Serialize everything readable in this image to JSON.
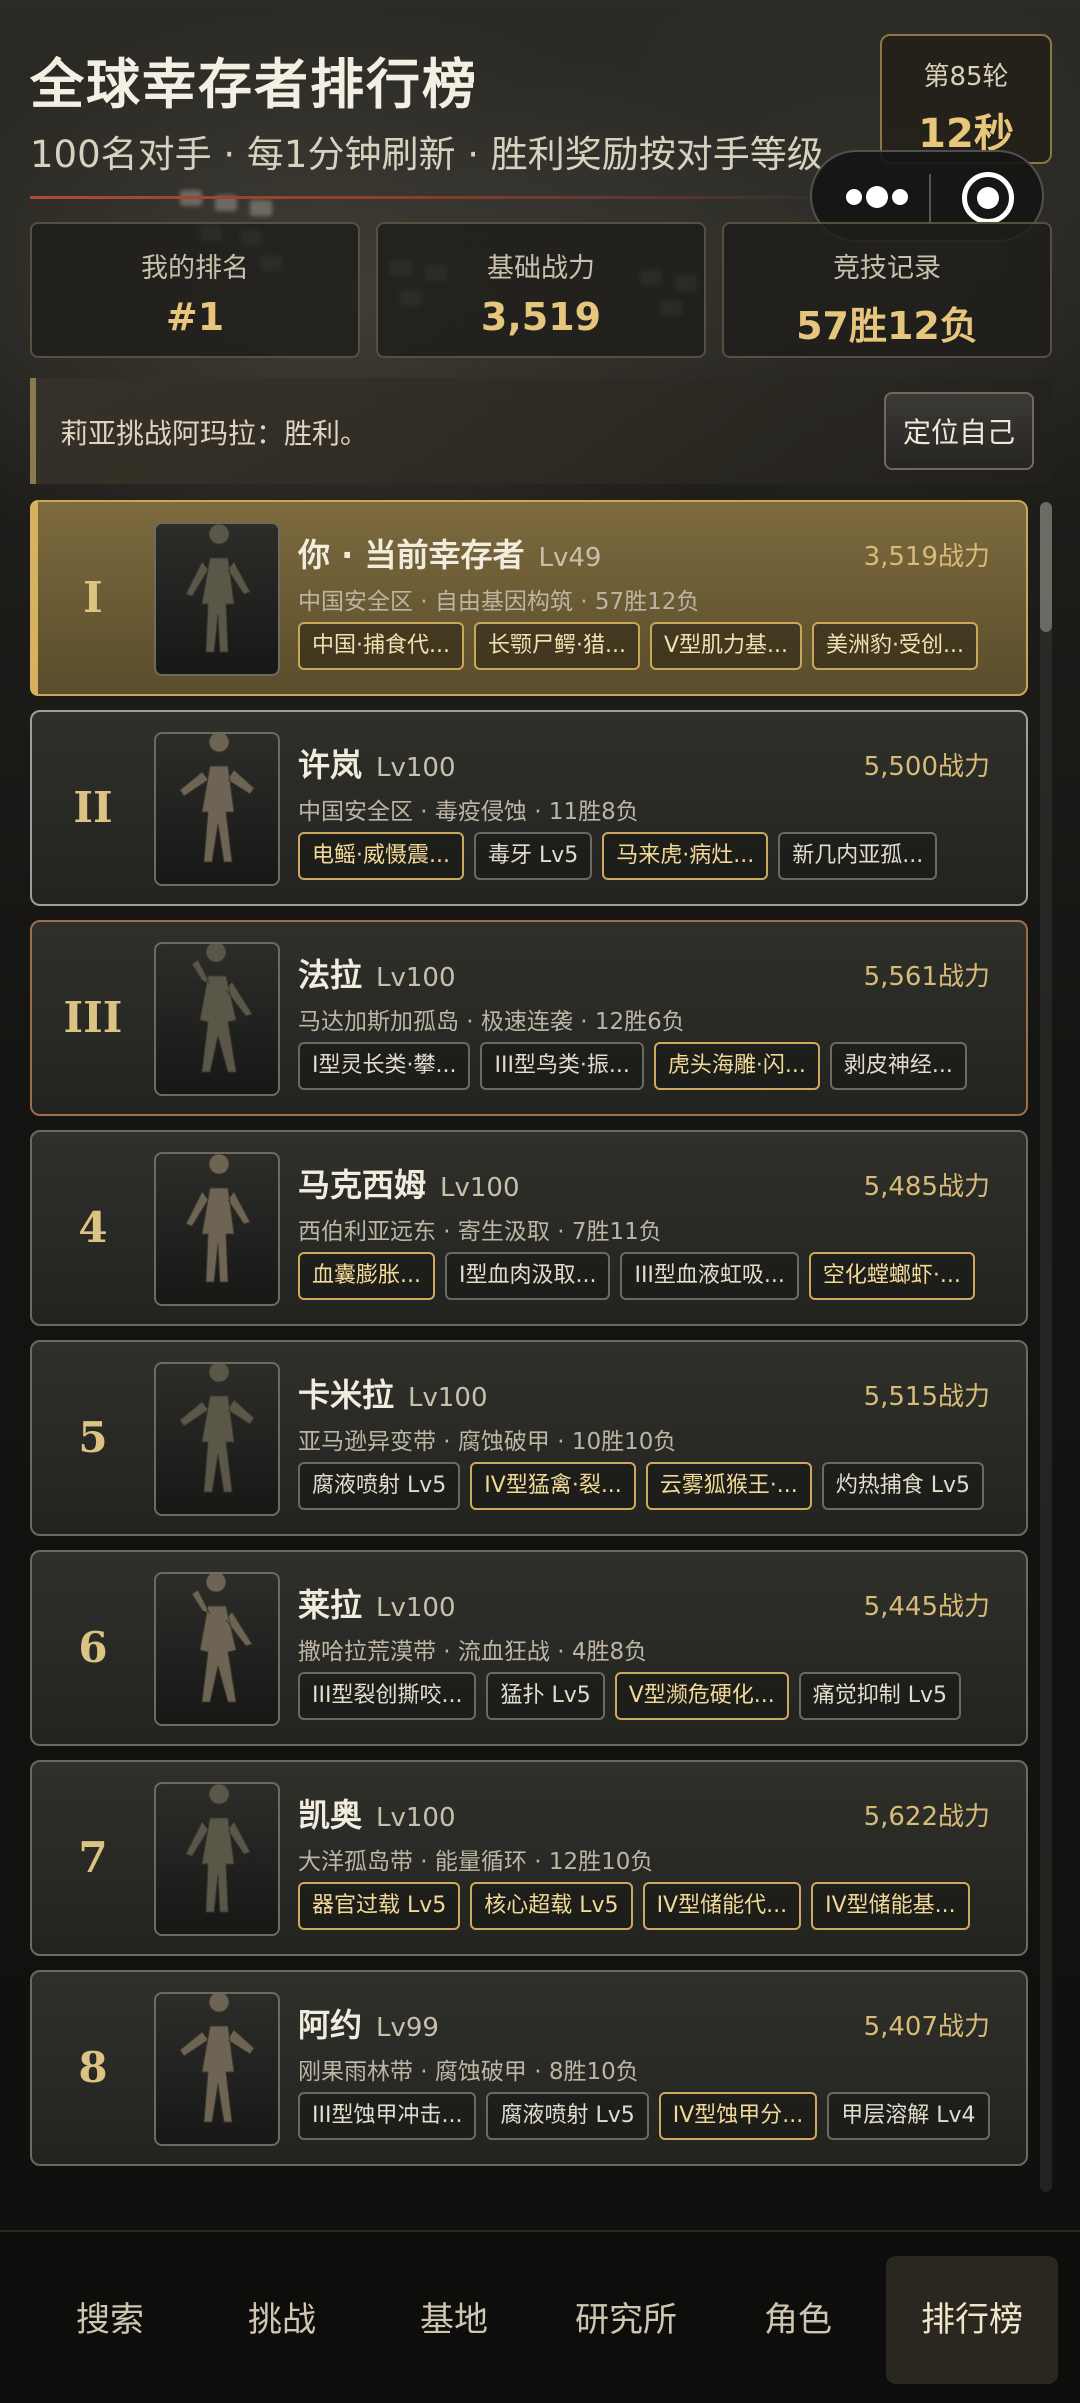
{
  "header": {
    "title": "全球幸存者排行榜",
    "subtitle": "100名对手 · 每1分钟刷新 · 胜利奖励按对手等级",
    "round_label": "第85轮",
    "round_countdown": "12秒"
  },
  "stats": [
    {
      "label": "我的排名",
      "value": "#1"
    },
    {
      "label": "基础战力",
      "value": "3,519"
    },
    {
      "label": "竞技记录",
      "value": "57胜12负"
    }
  ],
  "notice": {
    "text": "莉亚挑战阿玛拉：胜利。",
    "button": "定位自己"
  },
  "leaderboard": [
    {
      "rank": "I",
      "name": "你 · 当前幸存者",
      "level": "Lv49",
      "power": "3,519战力",
      "meta": "中国安全区 · 自由基因构筑 · 57胜12负",
      "tags": [
        {
          "text": "中国·捕食代...",
          "gold": true
        },
        {
          "text": "长颚尸鳄·猎...",
          "gold": true
        },
        {
          "text": "V型肌力基...",
          "gold": true
        },
        {
          "text": "美洲豹·受创...",
          "gold": true
        }
      ]
    },
    {
      "rank": "II",
      "name": "许岚",
      "level": "Lv100",
      "power": "5,500战力",
      "meta": "中国安全区 · 毒疫侵蚀 · 11胜8负",
      "tags": [
        {
          "text": "电鳐·威慑震...",
          "gold": true
        },
        {
          "text": "毒牙 Lv5",
          "gold": false
        },
        {
          "text": "马来虎·病灶...",
          "gold": true
        },
        {
          "text": "新几内亚孤...",
          "gold": false
        }
      ]
    },
    {
      "rank": "III",
      "name": "法拉",
      "level": "Lv100",
      "power": "5,561战力",
      "meta": "马达加斯加孤岛 · 极速连袭 · 12胜6负",
      "tags": [
        {
          "text": "I型灵长类·攀...",
          "gold": false
        },
        {
          "text": "III型鸟类·振...",
          "gold": false
        },
        {
          "text": "虎头海雕·闪...",
          "gold": true
        },
        {
          "text": "剥皮神经...",
          "gold": false
        }
      ]
    },
    {
      "rank": "4",
      "name": "马克西姆",
      "level": "Lv100",
      "power": "5,485战力",
      "meta": "西伯利亚远东 · 寄生汲取 · 7胜11负",
      "tags": [
        {
          "text": "血囊膨胀...",
          "gold": true
        },
        {
          "text": "I型血肉汲取...",
          "gold": false
        },
        {
          "text": "III型血液虹吸...",
          "gold": false
        },
        {
          "text": "空化螳螂虾·...",
          "gold": true
        }
      ]
    },
    {
      "rank": "5",
      "name": "卡米拉",
      "level": "Lv100",
      "power": "5,515战力",
      "meta": "亚马逊异变带 · 腐蚀破甲 · 10胜10负",
      "tags": [
        {
          "text": "腐液喷射 Lv5",
          "gold": false
        },
        {
          "text": "IV型猛禽·裂...",
          "gold": true
        },
        {
          "text": "云雾狐猴王·...",
          "gold": true
        },
        {
          "text": "灼热捕食 Lv5",
          "gold": false
        }
      ]
    },
    {
      "rank": "6",
      "name": "莱拉",
      "level": "Lv100",
      "power": "5,445战力",
      "meta": "撒哈拉荒漠带 · 流血狂战 · 4胜8负",
      "tags": [
        {
          "text": "III型裂创撕咬...",
          "gold": false
        },
        {
          "text": "猛扑 Lv5",
          "gold": false
        },
        {
          "text": "V型濒危硬化...",
          "gold": true
        },
        {
          "text": "痛觉抑制 Lv5",
          "gold": false
        }
      ]
    },
    {
      "rank": "7",
      "name": "凯奥",
      "level": "Lv100",
      "power": "5,622战力",
      "meta": "大洋孤岛带 · 能量循环 · 12胜10负",
      "tags": [
        {
          "text": "器官过载 Lv5",
          "gold": true
        },
        {
          "text": "核心超载 Lv5",
          "gold": true
        },
        {
          "text": "IV型储能代...",
          "gold": true
        },
        {
          "text": "IV型储能基...",
          "gold": true
        }
      ]
    },
    {
      "rank": "8",
      "name": "阿约",
      "level": "Lv99",
      "power": "5,407战力",
      "meta": "刚果雨林带 · 腐蚀破甲 · 8胜10负",
      "tags": [
        {
          "text": "III型蚀甲冲击...",
          "gold": false
        },
        {
          "text": "腐液喷射 Lv5",
          "gold": false
        },
        {
          "text": "IV型蚀甲分...",
          "gold": true
        },
        {
          "text": "甲层溶解 Lv4",
          "gold": false
        }
      ]
    }
  ],
  "nav": [
    {
      "label": "搜索",
      "active": false
    },
    {
      "label": "挑战",
      "active": false
    },
    {
      "label": "基地",
      "active": false
    },
    {
      "label": "研究所",
      "active": false
    },
    {
      "label": "角色",
      "active": false
    },
    {
      "label": "排行榜",
      "active": true
    }
  ],
  "colors": {
    "accent_gold": "#d8bb76",
    "highlight_card": "#7d6a3e",
    "nav_active": "#2a2720"
  }
}
